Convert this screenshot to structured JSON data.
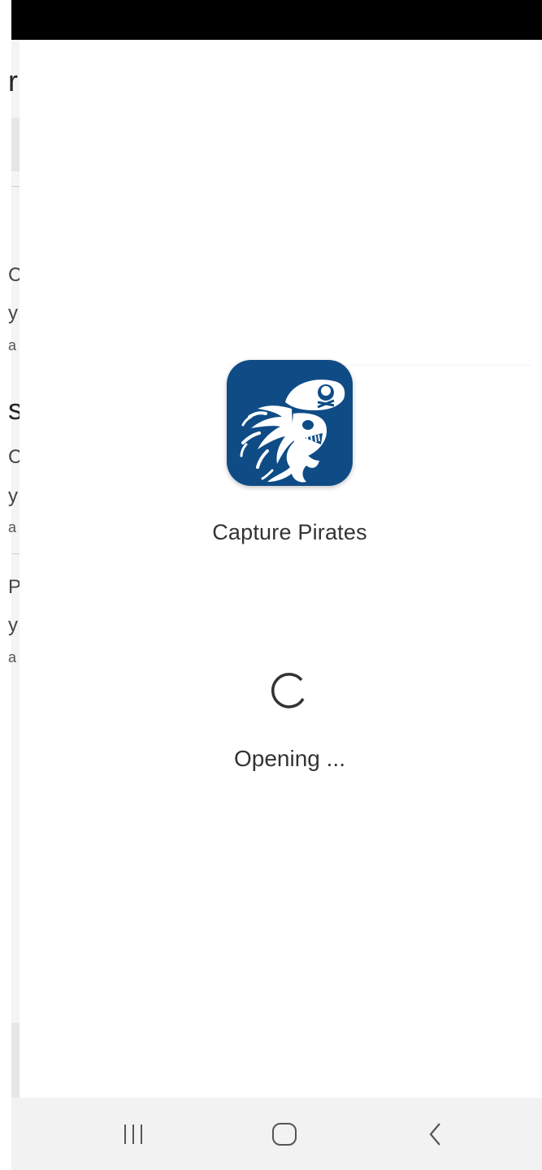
{
  "splash": {
    "app_name": "Capture Pirates",
    "status": "Opening ..."
  },
  "background_app": {
    "fragments": [
      "r",
      "Ca",
      "y",
      "a",
      "s",
      "Ca",
      "y",
      "a",
      "Pi",
      "y",
      "a"
    ]
  },
  "navigation": {
    "recents_icon": "recents-icon",
    "home_icon": "home-icon",
    "back_icon": "back-icon"
  },
  "colors": {
    "icon_background": "#0f4c86",
    "text": "#333333",
    "nav_background": "#f2f2f2",
    "status_bar": "#000000"
  }
}
